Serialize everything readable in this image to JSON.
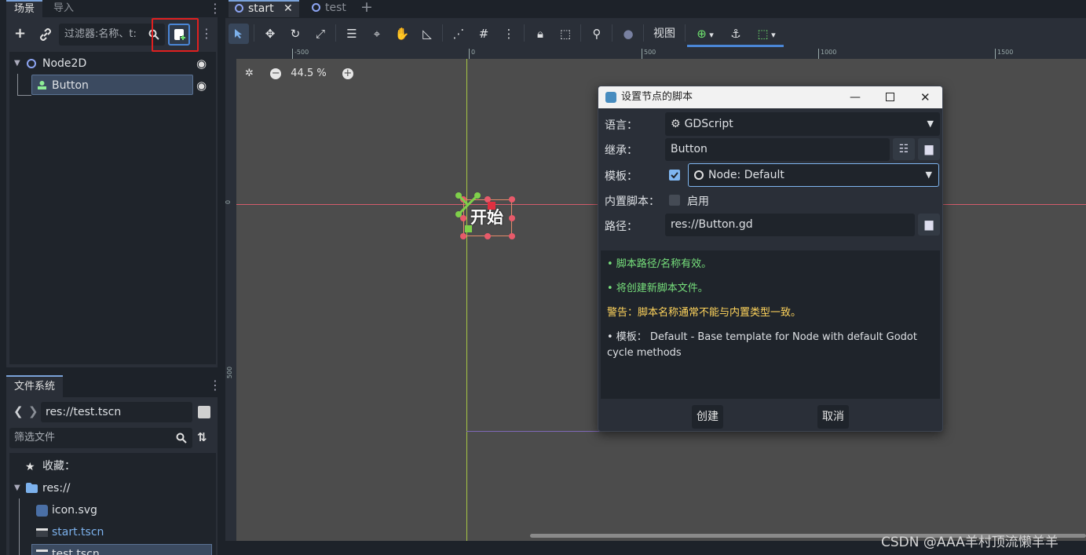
{
  "left_dock": {
    "tabs": [
      {
        "label": "场景"
      },
      {
        "label": "导入"
      }
    ],
    "filter_placeholder": "过滤器:名称、t:",
    "tree": [
      {
        "label": "Node2D"
      },
      {
        "label": "Button"
      }
    ]
  },
  "filesystem": {
    "tab": "文件系统",
    "path": "res://test.tscn",
    "filter_placeholder": "筛选文件",
    "favorites_label": "收藏：",
    "root_label": "res://",
    "files": [
      {
        "name": "icon.svg",
        "color": "#dde0e4"
      },
      {
        "name": "start.tscn",
        "color": "#7cb1ec"
      },
      {
        "name": "test.tscn",
        "color": "#dde0e4"
      }
    ]
  },
  "scene_tabs": [
    {
      "label": "start",
      "close": "✕"
    },
    {
      "label": "test"
    }
  ],
  "toolbar": {
    "view_label": "视图"
  },
  "ruler": {
    "top_labels": [
      "-500",
      "0",
      "500",
      "1000",
      "1500"
    ],
    "left_labels": [
      "0",
      "500"
    ]
  },
  "viewport": {
    "zoom": "44.5 %",
    "button_text": "开始"
  },
  "dialog": {
    "title": "设置节点的脚本",
    "language_label": "语言：",
    "language_value": "GDScript",
    "inherits_label": "继承：",
    "inherits_value": "Button",
    "template_label": "模板：",
    "template_value": "Node: Default",
    "builtin_label": "内置脚本：",
    "builtin_value": "启用",
    "path_label": "路径：",
    "path_value": "res://Button.gd",
    "status": [
      {
        "text": "• 脚本路径/名称有效。",
        "color": "#77e07c"
      },
      {
        "text": "• 将创建新脚本文件。",
        "color": "#77e07c"
      },
      {
        "text": "警告：脚本名称通常不能与内置类型一致。",
        "color": "#ffd45c"
      },
      {
        "text": "• 模板： Default - Base template for Node with default Godot cycle methods",
        "color": "#dde0e4"
      }
    ],
    "create_label": "创建",
    "cancel_label": "取消"
  },
  "watermark": "CSDN @AAA羊村顶流懒羊羊",
  "colors": {
    "accent": "#4a86d6",
    "highlight_box": "#e02020",
    "valid_text": "#77e07c",
    "warning_text": "#ffd45c"
  }
}
